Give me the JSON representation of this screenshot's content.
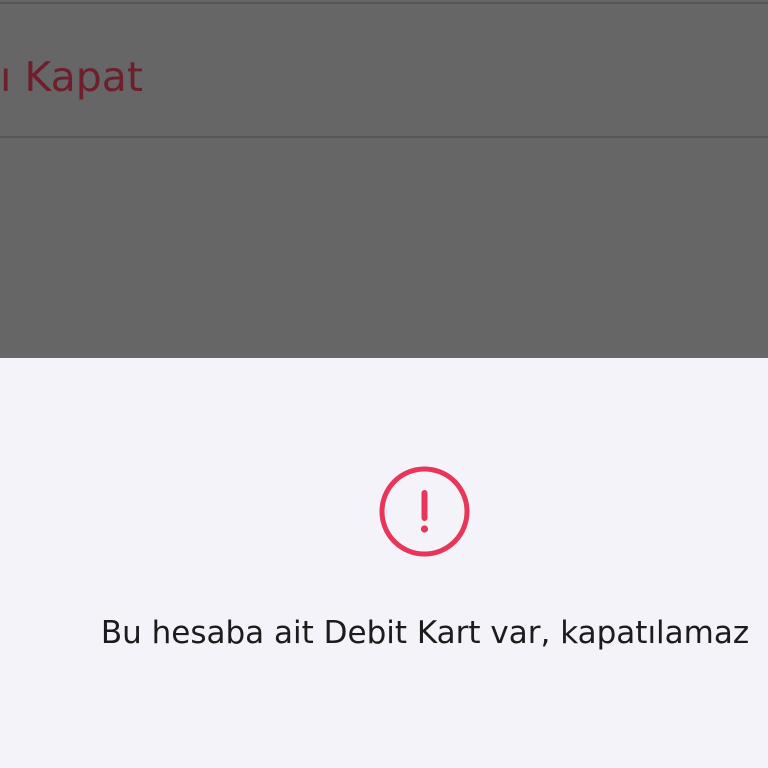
{
  "background": {
    "row_label": "ı Kapat"
  },
  "sheet": {
    "icon": "exclamation-circle-icon",
    "message": "Bu hesaba ait Debit Kart var, kapatılamaz"
  },
  "colors": {
    "alert": "#e8365a",
    "backdrop": "#666666",
    "sheet_background": "#f3f3f9",
    "muted_label": "#6e1f2c"
  }
}
